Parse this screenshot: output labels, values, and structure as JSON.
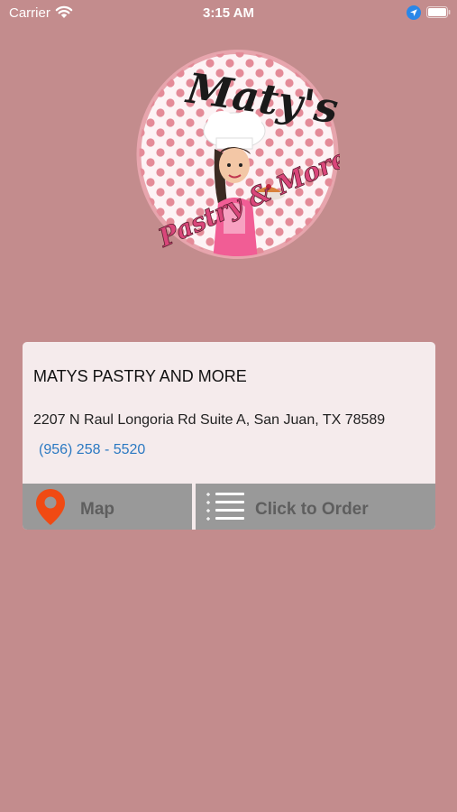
{
  "status_bar": {
    "carrier": "Carrier",
    "time": "3:15 AM"
  },
  "logo": {
    "brand_script": "Maty's",
    "brand_tagline": "Pastry & More",
    "colors": {
      "ring": "#e7a5ad",
      "dots": "#e48b98",
      "script": "#1a1a1a",
      "tagline": "#d9467a"
    }
  },
  "business": {
    "name": "MATYS PASTRY AND MORE",
    "address": "2207 N Raul Longoria Rd Suite A, San Juan, TX  78589",
    "phone": "(956) 258 - 5520"
  },
  "actions": {
    "map_label": "Map",
    "map_icon": "map-pin-icon",
    "order_label": "Click to Order",
    "order_icon": "list-icon"
  },
  "colors": {
    "background": "#c38c8d",
    "card": "#f5ebec",
    "button": "#999999",
    "phone_link": "#2b79c2",
    "map_pin": "#f04a13"
  }
}
